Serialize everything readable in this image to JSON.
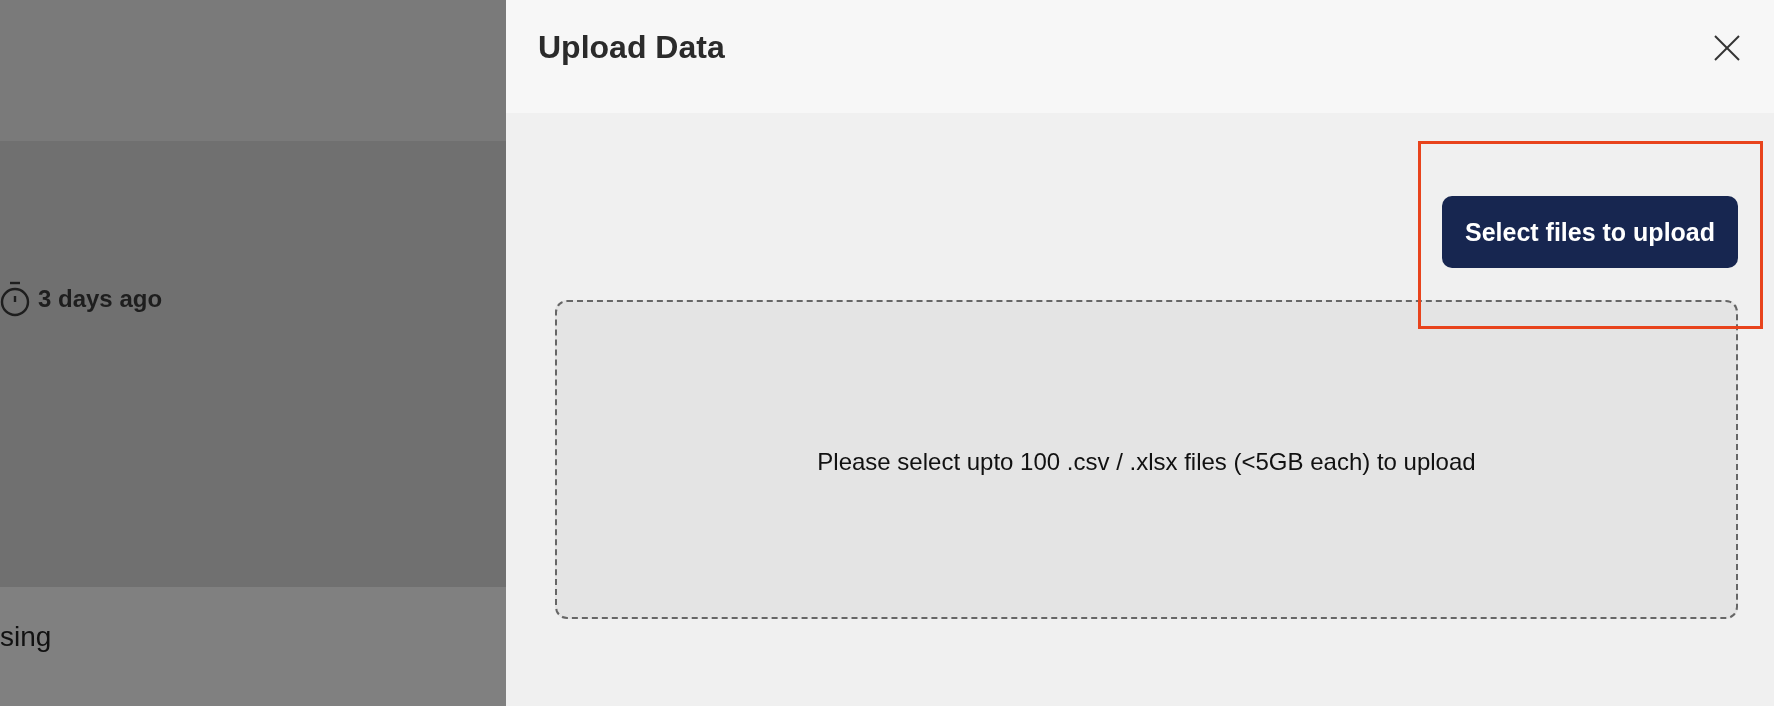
{
  "background": {
    "time_label": "3 days ago",
    "row_text": "sing"
  },
  "dialog": {
    "title": "Upload Data",
    "button": "Select files to upload",
    "button_highlighted": true,
    "dropzone_text": "Please select upto 100 .csv / .xlsx files (<5GB each) to upload"
  }
}
